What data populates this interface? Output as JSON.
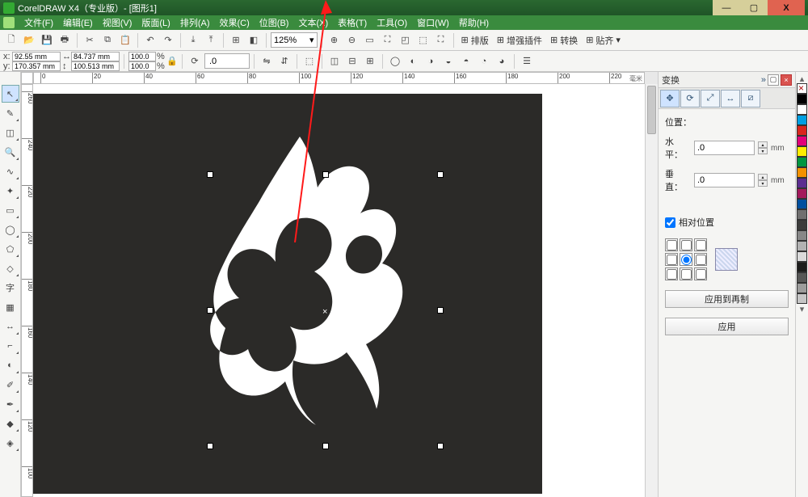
{
  "title": "CorelDRAW X4（专业版）- [图形1]",
  "menu": [
    "文件(F)",
    "编辑(E)",
    "视图(V)",
    "版面(L)",
    "排列(A)",
    "效果(C)",
    "位图(B)",
    "文本(X)",
    "表格(T)",
    "工具(O)",
    "窗口(W)",
    "帮助(H)"
  ],
  "toolbar1": {
    "zoom": "125%",
    "groups": [
      "排版",
      "增强插件",
      "转换",
      "贴齐"
    ]
  },
  "propbar": {
    "x": "92.55 mm",
    "y": "170.357 mm",
    "w": "84.737 mm",
    "h": "100.513 mm",
    "sx": "100.0",
    "sy": "100.0",
    "rot": ".0"
  },
  "ruler": {
    "unit_label": "毫米",
    "h_ticks": [
      0,
      20,
      40,
      60,
      80,
      100,
      120,
      140,
      160,
      180,
      200,
      220
    ],
    "v_ticks": [
      260,
      240,
      220,
      200,
      180,
      160,
      140,
      120,
      100
    ]
  },
  "docker": {
    "title": "变换",
    "pos_label": "位置：",
    "h_label": "水平：",
    "v_label": "垂直：",
    "hval": ".0",
    "vval": ".0",
    "unit": "mm",
    "relative": "相对位置",
    "apply_copy": "应用到再制",
    "apply": "应用"
  },
  "colors": [
    "#000000",
    "#ffffff",
    "#00a0e3",
    "#d9261c",
    "#e2007a",
    "#ffed00",
    "#009640",
    "#f39200",
    "#5b2d90",
    "#a3195b",
    "#004f9f",
    "#706f6f",
    "#3c3c3b",
    "#878787",
    "#b2b2b2",
    "#dadada",
    "#1d1d1b",
    "#575756",
    "#9d9d9c",
    "#c6c6c6"
  ]
}
